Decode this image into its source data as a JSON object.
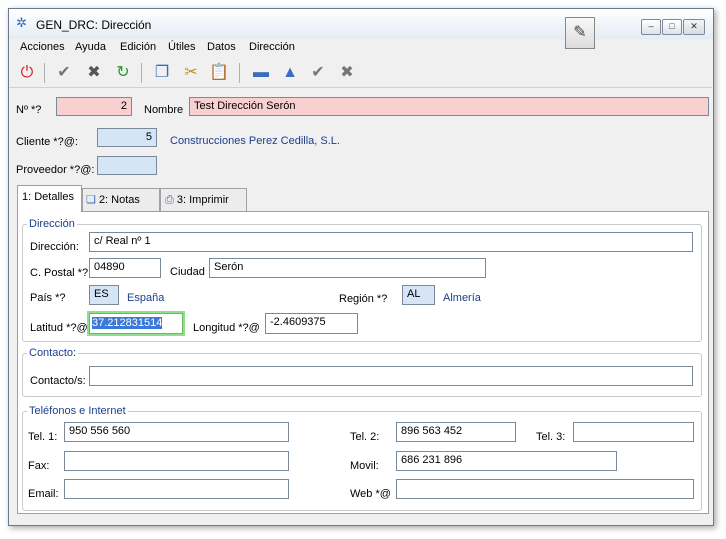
{
  "window": {
    "title": "GEN_DRC: Dirección"
  },
  "menu": [
    {
      "label": "Acciones"
    },
    {
      "label": "Ayuda"
    },
    {
      "label": "Edición"
    },
    {
      "label": "Útiles"
    },
    {
      "label": "Datos"
    },
    {
      "label": "Dirección"
    }
  ],
  "header": {
    "num_label": "Nº *?",
    "num_value": "2",
    "nombre_label": "Nombre",
    "nombre_value": "Test Dirección Serón",
    "cliente_label": "Cliente *?@:",
    "cliente_value": "5",
    "cliente_name": "Construcciones Perez Cedilla, S.L.",
    "proveedor_label": "Proveedor *?@:",
    "proveedor_value": ""
  },
  "tabs": [
    {
      "label": "1: Detalles"
    },
    {
      "label": "2: Notas"
    },
    {
      "label": "3: Imprimir"
    }
  ],
  "direccion": {
    "group_title": "Dirección",
    "direccion_label": "Dirección:",
    "direccion_value": "c/ Real nº 1",
    "cpostal_label": "C. Postal *?",
    "cpostal_value": "04890",
    "ciudad_label": "Ciudad",
    "ciudad_value": "Serón",
    "pais_label": "País *?",
    "pais_value": "ES",
    "pais_name": "España",
    "region_label": "Región *?",
    "region_value": "AL",
    "region_name": "Almería",
    "latitud_label": "Latitud *?@",
    "latitud_value": "37.212831514",
    "longitud_label": "Longitud *?@",
    "longitud_value": "-2.4609375"
  },
  "contacto": {
    "group_title": "Contacto:",
    "contacto_label": "Contacto/s:",
    "contacto_value": ""
  },
  "telefonos": {
    "group_title": "Teléfonos e Internet",
    "tel1_label": "Tel. 1:",
    "tel1_value": "950 556 560",
    "tel2_label": "Tel. 2:",
    "tel2_value": "896 563 452",
    "tel3_label": "Tel. 3:",
    "tel3_value": "",
    "fax_label": "Fax:",
    "fax_value": "",
    "movil_label": "Movil:",
    "movil_value": "686 231 896",
    "email_label": "Email:",
    "email_value": "",
    "web_label": "Web *@",
    "web_value": ""
  }
}
